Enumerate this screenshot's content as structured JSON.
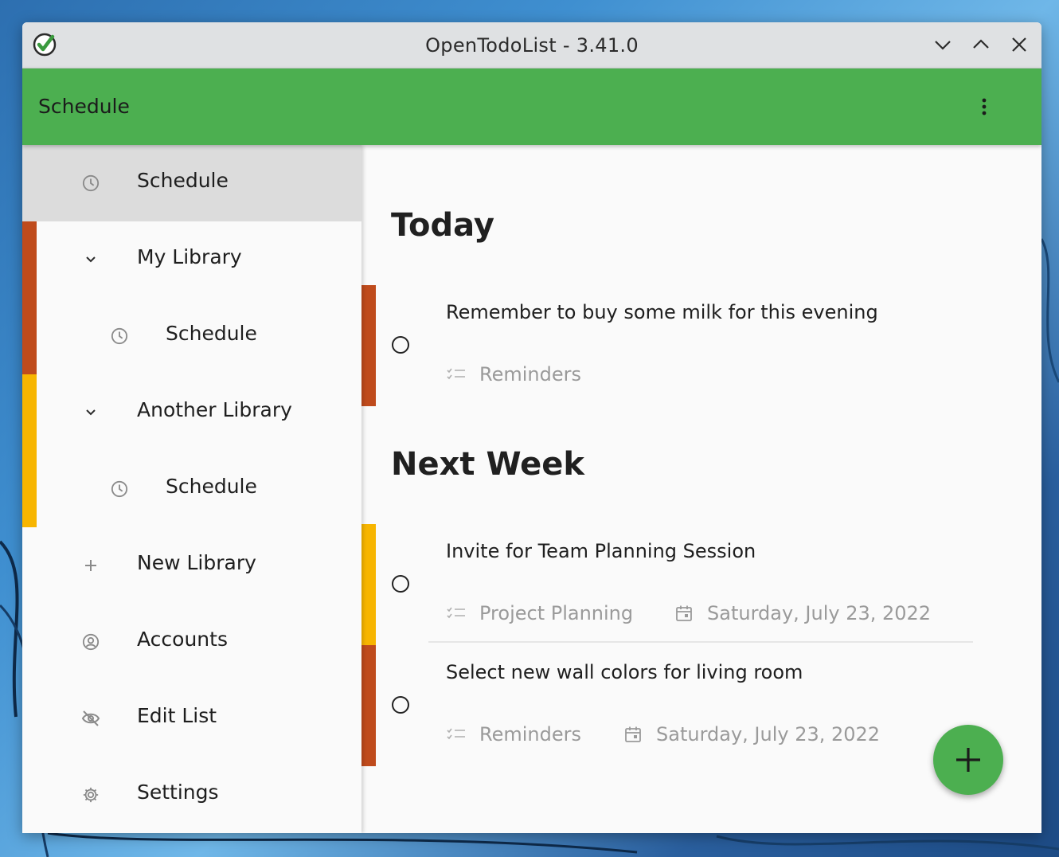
{
  "window": {
    "title": "OpenTodoList - 3.41.0"
  },
  "appbar": {
    "title": "Schedule",
    "menu_icon": "more-vertical-icon"
  },
  "drawer": {
    "items": [
      {
        "label": "Schedule",
        "icon": "clock-icon",
        "active": true
      },
      {
        "label": "My Library",
        "icon": "chevron-down-icon",
        "library_color": "#bf4b1c"
      },
      {
        "label": "Schedule",
        "icon": "clock-icon"
      },
      {
        "label": "Another Library",
        "icon": "chevron-down-icon",
        "library_color": "#f7b500"
      },
      {
        "label": "Schedule",
        "icon": "clock-icon"
      },
      {
        "label": "New Library",
        "icon": "plus-icon"
      },
      {
        "label": "Accounts",
        "icon": "account-circle-icon"
      },
      {
        "label": "Edit List",
        "icon": "eye-off-icon"
      },
      {
        "label": "Settings",
        "icon": "gear-icon"
      }
    ]
  },
  "sections": [
    {
      "heading": "Today",
      "todos": [
        {
          "title": "Remember to buy some milk for this evening",
          "library": "Reminders",
          "due": "",
          "color": "#bf4b1c"
        }
      ]
    },
    {
      "heading": "Next Week",
      "todos": [
        {
          "title": "Invite for Team Planning Session",
          "library": "Project Planning",
          "due": "Saturday, July 23, 2022",
          "color": "#f7b500"
        },
        {
          "title": "Select new wall colors for living room",
          "library": "Reminders",
          "due": "Saturday, July 23, 2022",
          "color": "#bf4b1c"
        }
      ]
    }
  ],
  "fab": {
    "icon": "plus-icon"
  },
  "colors": {
    "accent": "#4caf50",
    "library_red": "#bf4b1c",
    "library_yellow": "#f7b500"
  }
}
